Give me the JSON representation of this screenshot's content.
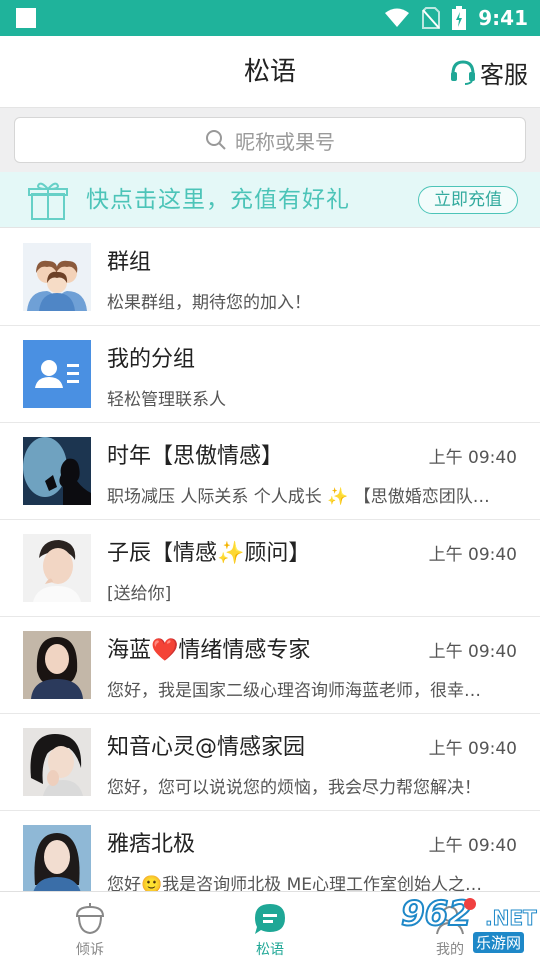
{
  "status_bar": {
    "time": "9:41"
  },
  "header": {
    "title": "松语",
    "service_label": "客服"
  },
  "search": {
    "placeholder": "昵称或果号"
  },
  "banner": {
    "text": "快点击这里，充值有好礼",
    "button_label": "立即充值"
  },
  "conversations": [
    {
      "name": "群组",
      "message": "松果群组，期待您的加入！",
      "time": ""
    },
    {
      "name": "我的分组",
      "message": "轻松管理联系人",
      "time": ""
    },
    {
      "name": "时年【思傲情感】",
      "message": "职场减压 人际关系 个人成长 ✨ 【思傲婚恋团队…",
      "time": "上午 09:40"
    },
    {
      "name": "子辰【情感✨顾问】",
      "message": "[送给你]",
      "time": "上午 09:40"
    },
    {
      "name": "海蓝❤️情绪情感专家",
      "message": "您好，我是国家二级心理咨询师海蓝老师，很幸…",
      "time": "上午 09:40"
    },
    {
      "name": "知音心灵@情感家园",
      "message": "您好，您可以说说您的烦恼，我会尽力帮您解决！",
      "time": "上午 09:40"
    },
    {
      "name": "雅痞北极",
      "message": "您好🙂我是咨询师北极 ME心理工作室创始人之…",
      "time": "上午 09:40"
    }
  ],
  "tabs": [
    {
      "label": "倾诉"
    },
    {
      "label": "松语"
    },
    {
      "label": "我的"
    }
  ],
  "watermark": {
    "logo": "962",
    "suffix": ".NET",
    "sub": "乐游网"
  },
  "colors": {
    "primary": "#1fb39b",
    "banner_text": "#4cc4b8",
    "service_icon": "#1fa796"
  }
}
